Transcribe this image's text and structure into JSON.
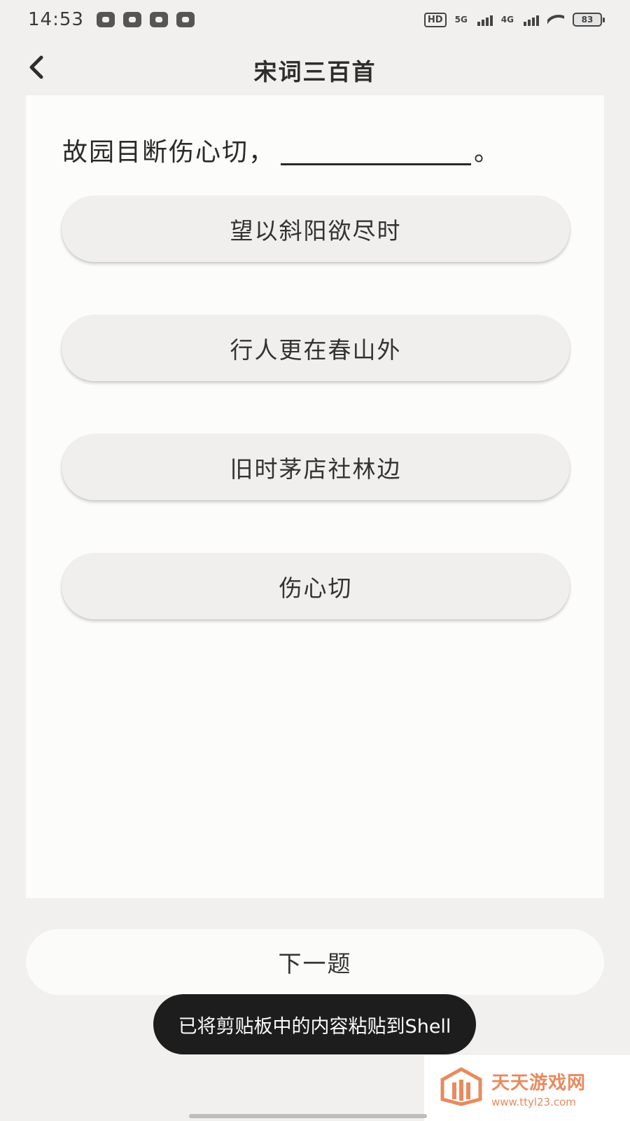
{
  "status_bar": {
    "time": "14:53",
    "hd_badge": "HD",
    "net_5g": "5G",
    "net_4g": "4G",
    "battery": "83"
  },
  "header": {
    "back_icon": "chevron-left-icon",
    "title": "宋词三百首"
  },
  "quiz": {
    "question_prefix": "故园目断伤心切，",
    "question_suffix": "。",
    "options": [
      {
        "label": "望以斜阳欲尽时"
      },
      {
        "label": "行人更在春山外"
      },
      {
        "label": "旧时茅店社林边"
      },
      {
        "label": "伤心切"
      }
    ],
    "next_label": "下一题"
  },
  "toast": {
    "message": "已将剪贴板中的内容粘贴到Shell"
  },
  "watermark": {
    "name": "天天游戏网",
    "url": "www.ttyl23.com"
  },
  "colors": {
    "background": "#f1f0ee",
    "card": "#fcfcfa",
    "option": "#f0efed",
    "toast": "#1d1d1d",
    "watermark_accent": "#e98a5e"
  }
}
